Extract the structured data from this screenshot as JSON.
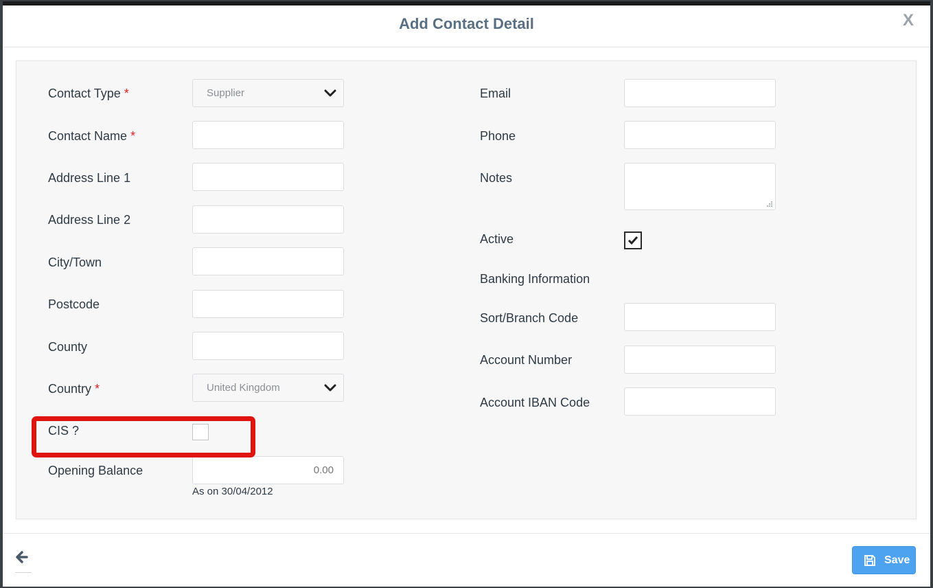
{
  "dialog": {
    "title": "Add Contact Detail",
    "close_label": "X"
  },
  "left": {
    "contact_type": {
      "label": "Contact Type",
      "required": "*",
      "value": "Supplier"
    },
    "contact_name": {
      "label": "Contact Name",
      "required": "*",
      "value": ""
    },
    "address_line_1": {
      "label": "Address Line 1",
      "value": ""
    },
    "address_line_2": {
      "label": "Address Line 2",
      "value": ""
    },
    "city_town": {
      "label": "City/Town",
      "value": ""
    },
    "postcode": {
      "label": "Postcode",
      "value": ""
    },
    "county": {
      "label": "County",
      "value": ""
    },
    "country": {
      "label": "Country",
      "required": "*",
      "value": "United Kingdom"
    },
    "cis": {
      "label": "CIS ?",
      "checked": false
    },
    "opening_balance": {
      "label": "Opening Balance",
      "placeholder": "0.00",
      "hint": "As on 30/04/2012"
    }
  },
  "right": {
    "email": {
      "label": "Email",
      "value": ""
    },
    "phone": {
      "label": "Phone",
      "value": ""
    },
    "notes": {
      "label": "Notes",
      "value": ""
    },
    "active": {
      "label": "Active",
      "checked": true
    },
    "banking_heading": "Banking Information",
    "sort_branch_code": {
      "label": "Sort/Branch Code",
      "value": ""
    },
    "account_number": {
      "label": "Account Number",
      "value": ""
    },
    "account_iban_code": {
      "label": "Account IBAN Code",
      "value": ""
    }
  },
  "footer": {
    "save_label": "Save",
    "back_icon": "arrow-left-icon",
    "save_icon": "floppy-disk-icon"
  },
  "colors": {
    "title": "#5b6f82",
    "required": "#e02222",
    "save_button": "#4ea3f1",
    "highlight": "#e0140f"
  }
}
